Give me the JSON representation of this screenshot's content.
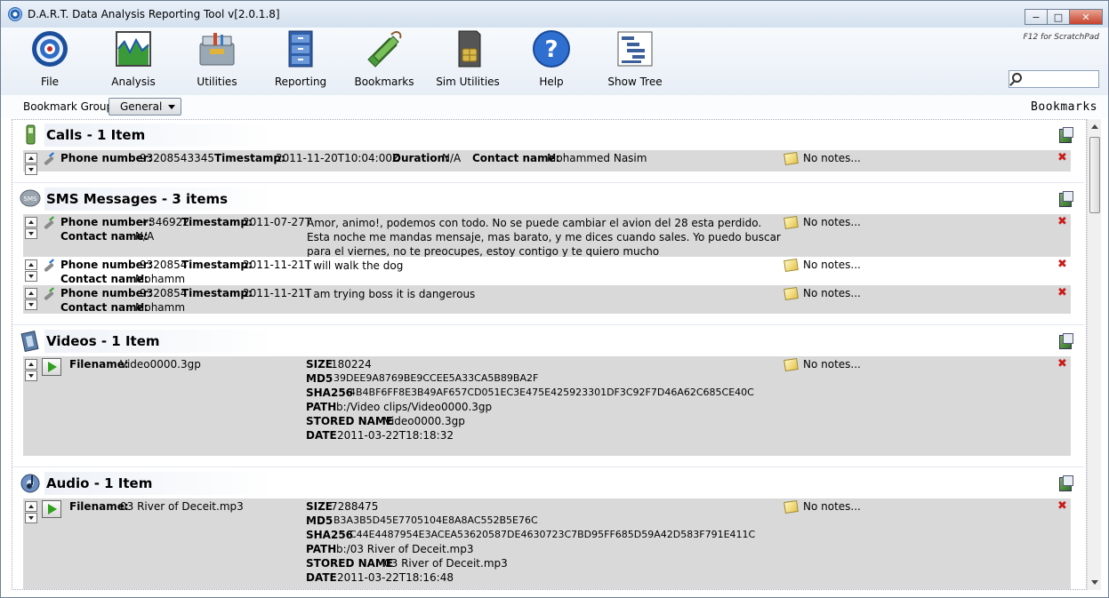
{
  "window": {
    "title": "D.A.R.T. Data Analysis Reporting Tool v[2.0.1.8]",
    "minimize": "−",
    "maximize": "□",
    "close": "✕",
    "scratchpad_hint": "F12 for ScratchPad"
  },
  "toolbar": [
    {
      "label": "File",
      "icon": "file-icon"
    },
    {
      "label": "Analysis",
      "icon": "analysis-icon"
    },
    {
      "label": "Utilities",
      "icon": "utilities-icon"
    },
    {
      "label": "Reporting",
      "icon": "reporting-icon"
    },
    {
      "label": "Bookmarks",
      "icon": "bookmarks-icon"
    },
    {
      "label": "Sim Utilities",
      "icon": "sim-card-icon"
    },
    {
      "label": "Help",
      "icon": "help-icon"
    },
    {
      "label": "Show Tree",
      "icon": "tree-icon"
    }
  ],
  "search": {
    "placeholder": ""
  },
  "bookmark_group": {
    "label": "Bookmark Group",
    "selected": "General"
  },
  "panel_title": "Bookmarks",
  "notes_text": "No notes...",
  "calls": {
    "title": "Calls - 1 Item",
    "rows": [
      {
        "phone_label": "Phone number:",
        "phone": "93208543345",
        "timestamp_label": "Timestamp:",
        "timestamp": "2011-11-20T10:04:00Z",
        "duration_label": "Duration:",
        "duration": "N/A",
        "contact_label": "Contact name:",
        "contact": "Mohammed Nasim"
      }
    ]
  },
  "sms": {
    "title": "SMS Messages - 3 items",
    "rows": [
      {
        "phone_label": "Phone number:",
        "phone": "+346922",
        "timestamp_label": "Timestamp:",
        "timestamp": "2011-07-27T",
        "contact_label": "Contact name:",
        "contact": "N/A",
        "body": "Amor, animo!, podemos con todo. No se puede cambiar el avion del 28 esta perdido. Esta noche me mandas mensaje, mas barato, y me dices cuando sales. Yo puedo buscar para el viernes, no te preocupes, estoy contigo y te quiero mucho"
      },
      {
        "phone_label": "Phone number:",
        "phone": "9320854",
        "timestamp_label": "Timestamp:",
        "timestamp": "2011-11-21T",
        "contact_label": "Contact name:",
        "contact": "Mohamm",
        "body": "I will walk the dog"
      },
      {
        "phone_label": "Phone number:",
        "phone": "9320854",
        "timestamp_label": "Timestamp:",
        "timestamp": "2011-11-21T",
        "contact_label": "Contact name:",
        "contact": "Mohamm",
        "body": "I am trying boss it is dangerous"
      }
    ]
  },
  "videos": {
    "title": "Videos - 1 Item",
    "rows": [
      {
        "filename_label": "Filename:",
        "filename": "Video0000.3gp",
        "size_label": "SIZE",
        "size": "180224",
        "md5_label": "MD5",
        "md5": "39DEE9A8769BE9CCEE5A33CA5B89BA2F",
        "sha_label": "SHA256",
        "sha": "4B4BF6FF8E3B49AF657CD051EC3E475E425923301DF3C92F7D46A62C685CE40C",
        "path_label": "PATH",
        "path": "b:/Video clips/Video0000.3gp",
        "stored_label": "STORED NAME",
        "stored": "Video0000.3gp",
        "date_label": "DATE",
        "date": "2011-03-22T18:18:32"
      }
    ]
  },
  "audio": {
    "title": "Audio - 1 Item",
    "rows": [
      {
        "filename_label": "Filename:",
        "filename": "03 River of Deceit.mp3",
        "size_label": "SIZE",
        "size": "7288475",
        "md5_label": "MD5",
        "md5": "B3A3B5D45E7705104E8A8AC552B5E76C",
        "sha_label": "SHA256",
        "sha": "C44E4487954E3ACEA53620587DE4630723C7BD95FF685D59A42D583F791E411C",
        "path_label": "PATH",
        "path": "b:/03 River of Deceit.mp3",
        "stored_label": "STORED NAME",
        "stored": "03 River of Deceit.mp3",
        "date_label": "DATE",
        "date": "2011-03-22T18:16:48"
      }
    ]
  }
}
